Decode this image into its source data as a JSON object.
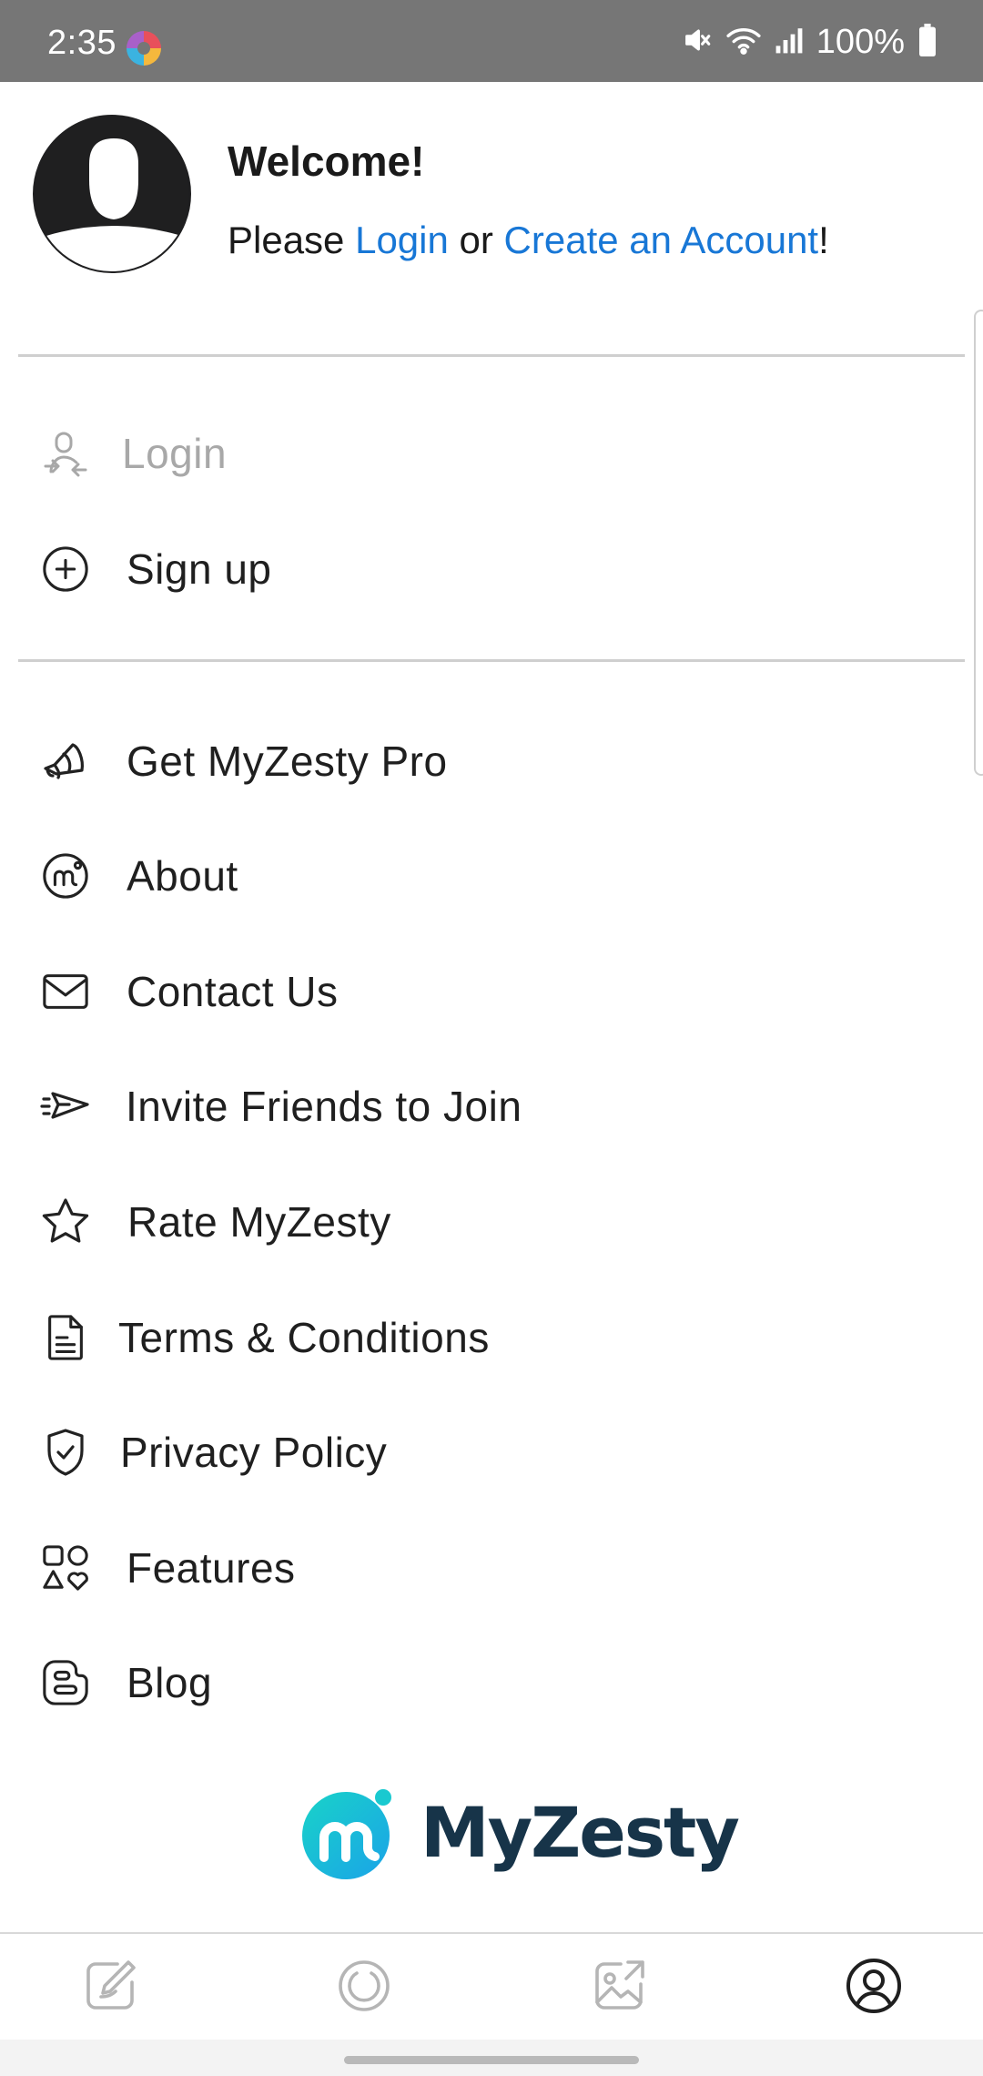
{
  "status_bar": {
    "time": "2:35",
    "battery_text": "100%",
    "icons": [
      "app-notification-icon",
      "mute-icon",
      "wifi-icon",
      "cellular-signal-icon",
      "battery-icon"
    ]
  },
  "header": {
    "title": "Welcome!",
    "prompt_prefix": "Please ",
    "login_link": "Login",
    "prompt_middle": " or ",
    "create_account_link": "Create an Account",
    "prompt_suffix": "!"
  },
  "auth_menu": [
    {
      "label": "Login",
      "icon": "login-user-icon",
      "disabled": true
    },
    {
      "label": "Sign up",
      "icon": "plus-circle-icon",
      "disabled": false
    }
  ],
  "main_menu": [
    {
      "label": "Get MyZesty Pro",
      "icon": "megaphone-icon"
    },
    {
      "label": "About",
      "icon": "myzesty-logo-icon"
    },
    {
      "label": "Contact Us",
      "icon": "envelope-icon"
    },
    {
      "label": "Invite Friends to Join",
      "icon": "paper-plane-icon"
    },
    {
      "label": "Rate MyZesty",
      "icon": "star-icon"
    },
    {
      "label": "Terms & Conditions",
      "icon": "document-icon"
    },
    {
      "label": "Privacy Policy",
      "icon": "shield-check-icon"
    },
    {
      "label": "Features",
      "icon": "shapes-icon"
    },
    {
      "label": "Blog",
      "icon": "blogger-icon"
    }
  ],
  "brand": {
    "name": "MyZesty"
  },
  "bottom_nav": [
    {
      "icon": "edit-icon",
      "active": false
    },
    {
      "icon": "loading-circle-icon",
      "active": false
    },
    {
      "icon": "share-image-icon",
      "active": false
    },
    {
      "icon": "profile-icon",
      "active": true
    }
  ],
  "colors": {
    "link": "#1877d6",
    "brand_teal": "#1cc4d8",
    "brand_dark": "#173449",
    "status_bar": "#767676",
    "inactive_icon": "#b5b5b5"
  }
}
